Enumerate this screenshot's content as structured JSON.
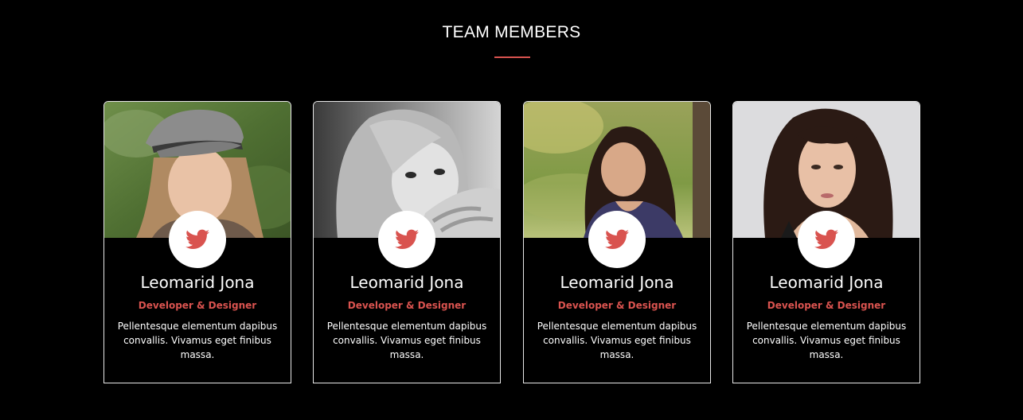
{
  "section": {
    "title": "TEAM MEMBERS",
    "accent_color": "#d9534f"
  },
  "members": [
    {
      "name": "Leomarid Jona",
      "role": "Developer & Designer",
      "bio": "Pellentesque elementum dapibus convallis. Vivamus eget finibus massa.",
      "social_icon": "twitter-icon"
    },
    {
      "name": "Leomarid Jona",
      "role": "Developer & Designer",
      "bio": "Pellentesque elementum dapibus convallis. Vivamus eget finibus massa.",
      "social_icon": "twitter-icon"
    },
    {
      "name": "Leomarid Jona",
      "role": "Developer & Designer",
      "bio": "Pellentesque elementum dapibus convallis. Vivamus eget finibus massa.",
      "social_icon": "twitter-icon"
    },
    {
      "name": "Leomarid Jona",
      "role": "Developer & Designer",
      "bio": "Pellentesque elementum dapibus convallis. Vivamus eget finibus massa.",
      "social_icon": "twitter-icon"
    }
  ]
}
